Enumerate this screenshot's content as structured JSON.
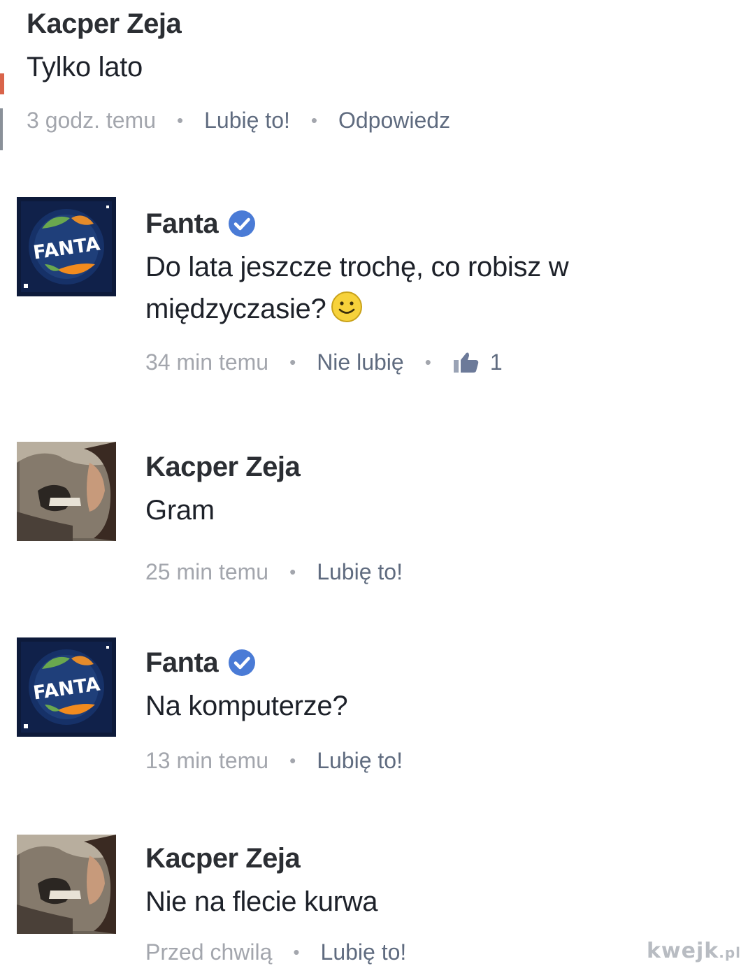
{
  "comments": [
    {
      "author": "Kacper Zeja",
      "text": "Tylko lato",
      "time": "3 godz. temu",
      "actions": [
        "Lubię to!",
        "Odpowiedz"
      ]
    },
    {
      "author": "Fanta",
      "verified": true,
      "avatar_label": "FANTA",
      "text": "Do lata jeszcze trochę, co robisz w międzyczasie?",
      "time": "34 min temu",
      "actions": [
        "Nie lubię"
      ],
      "likes": "1"
    },
    {
      "author": "Kacper Zeja",
      "text": "Gram",
      "time": "25 min temu",
      "actions": [
        "Lubię to!"
      ]
    },
    {
      "author": "Fanta",
      "verified": true,
      "avatar_label": "FANTA",
      "text": "Na komputerze?",
      "time": "13 min temu",
      "actions": [
        "Lubię to!"
      ]
    },
    {
      "author": "Kacper Zeja",
      "text": "Nie na flecie kurwa",
      "time": "Przed chwilą",
      "actions": [
        "Lubię to!"
      ]
    }
  ],
  "icons": {
    "verified": "verified-badge-icon",
    "smiley": "smiley-emoji-icon",
    "like": "thumbs-up-icon"
  },
  "colors": {
    "verified_blue": "#4a7bd6",
    "fanta_orange": "#f28b1e",
    "fanta_green": "#6aa84f",
    "meta_gray": "#a3a6ad"
  },
  "watermark": {
    "brand": "kwejk",
    "suffix": ".pl"
  }
}
